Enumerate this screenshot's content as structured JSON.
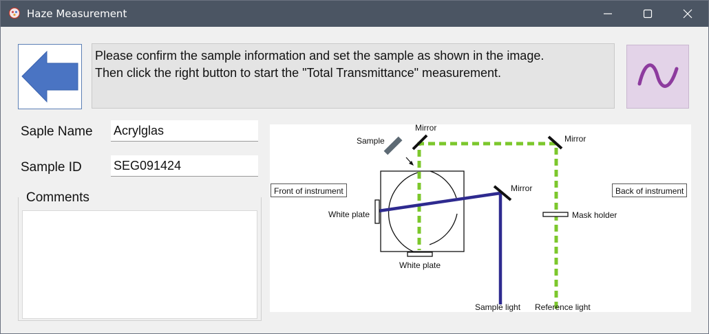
{
  "window": {
    "title": "Haze Measurement",
    "controls": {
      "minimize": "minimize",
      "maximize": "maximize",
      "close": "close"
    }
  },
  "header": {
    "message_lines": [
      "Please confirm the sample information and set the sample as shown in the image.",
      "Then click the right button to start the \"Total Transmittance\" measurement."
    ],
    "back_button_icon": "left-arrow-icon",
    "start_button_icon": "sine-wave-icon"
  },
  "form": {
    "sample_name_label": "Saple Name",
    "sample_name_value": "Acrylglas",
    "sample_id_label": "Sample ID",
    "sample_id_value": "SEG091424",
    "comments_label": "Comments",
    "comments_value": ""
  },
  "diagram": {
    "front_label": "Front of instrument",
    "back_label": "Back of instrument",
    "sample_label": "Sample",
    "mirror_top_left": "Mirror",
    "mirror_top_right": "Mirror",
    "mirror_middle": "Mirror",
    "white_plate_left": "White plate",
    "white_plate_bottom": "White plate",
    "mask_holder": "Mask holder",
    "sample_light": "Sample light",
    "reference_light": "Reference light"
  },
  "colors": {
    "titlebar": "#4b5563",
    "arrow": "#4a74c3",
    "sample_beam": "#2e2a8f",
    "reference_beam": "#7cc72c",
    "start_button": "#e3d3e8",
    "wave": "#8d3b9e"
  }
}
